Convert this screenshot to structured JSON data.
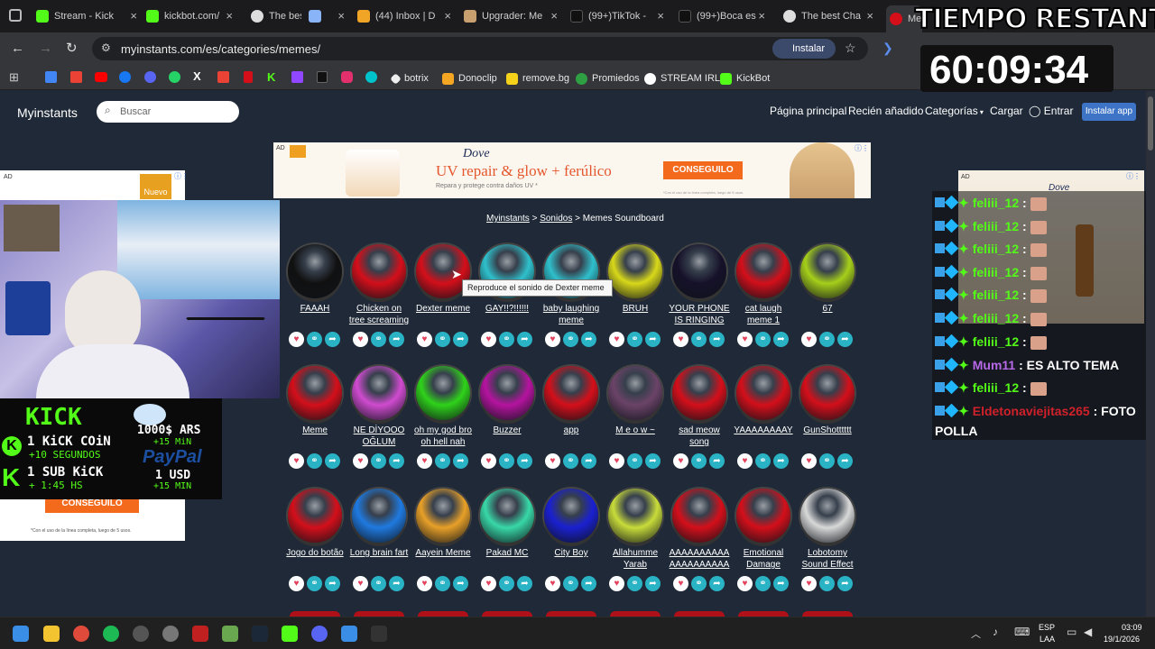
{
  "browser": {
    "tabs": [
      "Stream - Kick",
      "kickbot.com/",
      "The best",
      "",
      "(44) Inbox | D",
      "Upgrader: Me",
      "(99+)TikTok -",
      "(99+)Boca es",
      "The best Cha",
      "Me"
    ],
    "url": "myinstants.com/es/categories/memes/",
    "install_label": "Instalar",
    "bookmarks": [
      "botrix",
      "Donoclip",
      "remove.bg",
      "Promiedos",
      "STREAM IRL",
      "KickBot"
    ]
  },
  "site": {
    "logo": "Myinstants",
    "search_placeholder": "Buscar",
    "nav": [
      "Página principal",
      "Recién añadido",
      "Categorías",
      "Cargar",
      "Entrar"
    ],
    "install_app": "Instalar app",
    "breadcrumb": {
      "home": "Myinstants",
      "sep": ">",
      "sounds": "Sonidos",
      "current": "Memes Soundboard"
    },
    "tooltip": "Reproduce el sonido de Dexter meme",
    "ad": {
      "label": "AD",
      "brand": "Dove",
      "headline": "UV repair & glow + ferúlico",
      "sub": "Repara y protege contra daños UV *",
      "cta": "CONSEGUILO",
      "fine": "*Con el uso de la línea completa, luego de 5 usos."
    },
    "left_ad": {
      "label": "AD",
      "badge": "Nuevo",
      "cta": "CONSEGUILO",
      "fine": "*Con el uso de la línea completa, luego de 5 usos."
    },
    "buttons_row1": [
      {
        "l1": "FAAAH",
        "l2": "",
        "c": "#111111"
      },
      {
        "l1": "Chicken on",
        "l2": "tree screaming",
        "c": "#d40f1a"
      },
      {
        "l1": "Dexter meme",
        "l2": "",
        "c": "#d40f1a"
      },
      {
        "l1": "GAY!!?!!!!!!",
        "l2": "",
        "c": "#2fc0cc"
      },
      {
        "l1": "baby laughing",
        "l2": "meme",
        "c": "#2fc0cc"
      },
      {
        "l1": "BRUH",
        "l2": "",
        "c": "#d8d81a"
      },
      {
        "l1": "YOUR PHONE",
        "l2": "IS RINGING",
        "c": "#16112a"
      },
      {
        "l1": "cat laugh",
        "l2": "meme 1",
        "c": "#d40f1a"
      },
      {
        "l1": "67",
        "l2": "",
        "c": "#a6cf1a"
      }
    ],
    "buttons_row2": [
      {
        "l1": "Meme",
        "l2": "",
        "c": "#d40f1a"
      },
      {
        "l1": "NE DİYOOO",
        "l2": "OĞLUM",
        "c": "#d04bd0"
      },
      {
        "l1": "oh my god bro",
        "l2": "oh hell nah",
        "c": "#2fd21a"
      },
      {
        "l1": "Buzzer",
        "l2": "",
        "c": "#b5139f"
      },
      {
        "l1": "app",
        "l2": "",
        "c": "#d40f1a"
      },
      {
        "l1": "M e o w ~",
        "l2": "",
        "c": "#6b4368"
      },
      {
        "l1": "sad meow",
        "l2": "song",
        "c": "#d40f1a"
      },
      {
        "l1": "YAAAAAAAAY",
        "l2": "",
        "c": "#d40f1a"
      },
      {
        "l1": "GunShotttttt",
        "l2": "",
        "c": "#d40f1a"
      }
    ],
    "buttons_row3": [
      {
        "l1": "Jogo do botão",
        "l2": "",
        "c": "#d40f1a"
      },
      {
        "l1": "Long brain fart",
        "l2": "",
        "c": "#1f7ae0"
      },
      {
        "l1": "Aayein Meme",
        "l2": "",
        "c": "#e8a028"
      },
      {
        "l1": "Pakad MC",
        "l2": "",
        "c": "#38d8a8"
      },
      {
        "l1": "City Boy",
        "l2": "",
        "c": "#1a20d0"
      },
      {
        "l1": "Allahumme",
        "l2": "Yarab",
        "c": "#c8dc3a"
      },
      {
        "l1": "AAAAAAAAAA",
        "l2": "AAAAAAAAAA",
        "c": "#d40f1a"
      },
      {
        "l1": "Emotional",
        "l2": "Damage",
        "c": "#d40f1a"
      },
      {
        "l1": "Lobotomy",
        "l2": "Sound Effect",
        "c": "#d8d8d8"
      }
    ]
  },
  "overlay": {
    "timer_title": "TIEMPO RESTANTE:",
    "timer_value": "60:09:34",
    "kick_title": "KICK",
    "kick_coin": "1 KiCK COiN",
    "kick_coin_time": "+10 SEGUNDOS",
    "sub": "1 SUB KiCK",
    "sub_time": "+ 1:45 HS",
    "ars": "1000$ ARS",
    "ars_time": "+15 MiN",
    "paypal": "PayPal",
    "usd": "1 USD",
    "usd_time": "+15 MIN",
    "chat": [
      {
        "user": "feliii_12",
        "msg": "",
        "ucolor": "#53fc18"
      },
      {
        "user": "feliii_12",
        "msg": "",
        "ucolor": "#53fc18"
      },
      {
        "user": "feliii_12",
        "msg": "",
        "ucolor": "#53fc18"
      },
      {
        "user": "feliii_12",
        "msg": "",
        "ucolor": "#53fc18"
      },
      {
        "user": "feliii_12",
        "msg": "",
        "ucolor": "#53fc18"
      },
      {
        "user": "feliii_12",
        "msg": "",
        "ucolor": "#53fc18"
      },
      {
        "user": "feliii_12",
        "msg": "",
        "ucolor": "#53fc18"
      },
      {
        "user": "Mum11",
        "msg": "ES ALTO TEMA",
        "ucolor": "#b768e8"
      },
      {
        "user": "feliii_12",
        "msg": "",
        "ucolor": "#53fc18"
      },
      {
        "user": "Eldetonaviejitas265",
        "msg": "FOTO",
        "ucolor": "#d0202a"
      }
    ],
    "chat_wrap": "POLLA"
  },
  "taskbar": {
    "lang": "ESP",
    "lang2": "LAA",
    "time": "03:09",
    "date": "19/1/2026"
  }
}
